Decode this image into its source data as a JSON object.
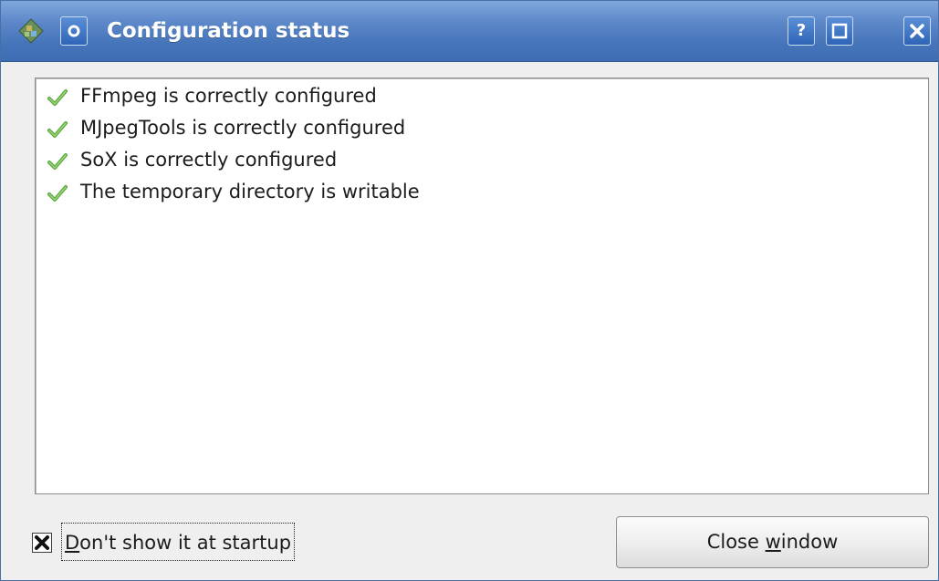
{
  "window": {
    "title": "Configuration status",
    "help_button": "?",
    "colors": {
      "titlebar": "#4675bb",
      "check": "#5aa83c"
    }
  },
  "status_items": [
    {
      "icon": "green-check-icon",
      "text": "FFmpeg is correctly configured"
    },
    {
      "icon": "green-check-icon",
      "text": "MJpegTools is correctly configured"
    },
    {
      "icon": "green-check-icon",
      "text": "SoX is correctly configured"
    },
    {
      "icon": "green-check-icon",
      "text": "The temporary directory is writable"
    }
  ],
  "startup_checkbox": {
    "mnemonic": "D",
    "label_rest": "on't show it at startup",
    "checked": true
  },
  "close_button": {
    "prefix": "Close ",
    "mnemonic": "w",
    "suffix": "indow"
  }
}
